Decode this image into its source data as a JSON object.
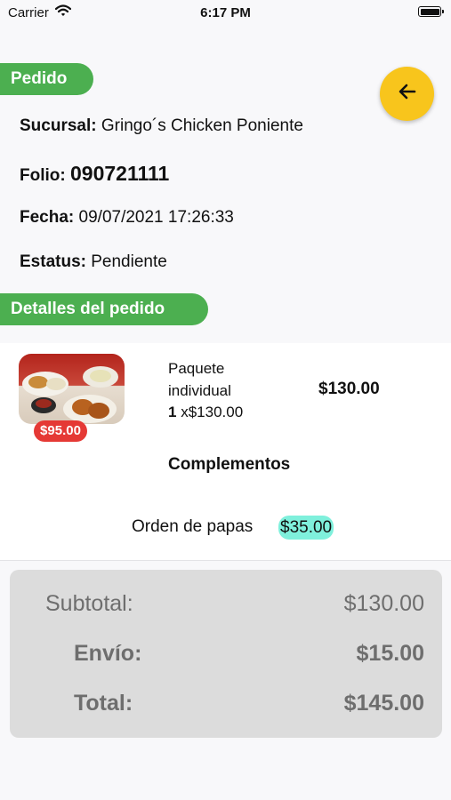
{
  "status_bar": {
    "carrier": "Carrier",
    "time": "6:17 PM"
  },
  "order": {
    "section_title": "Pedido",
    "sucursal_label": "Sucursal:",
    "sucursal_value": "Gringo´s Chicken Poniente",
    "folio_label": "Folio:",
    "folio_value": "090721111",
    "fecha_label": "Fecha:",
    "fecha_value": "09/07/2021 17:26:33",
    "estatus_label": "Estatus:",
    "estatus_value": "Pendiente"
  },
  "details": {
    "section_title": "Detalles del pedido",
    "item": {
      "badge_price": "$95.00",
      "name": "Paquete individual",
      "quantity": "1",
      "unit_price": "x$130.00",
      "total": "$130.00"
    },
    "complementos_title": "Complementos",
    "complementos": [
      {
        "name": "Orden de papas",
        "price": "$35.00"
      }
    ]
  },
  "totals": {
    "subtotal_label": "Subtotal:",
    "subtotal_value": "$130.00",
    "envio_label": "Envío:",
    "envio_value": "$15.00",
    "total_label": "Total:",
    "total_value": "$145.00"
  },
  "colors": {
    "accent_green": "#4caf50",
    "back_button": "#f8c51c",
    "badge_red": "#e53935",
    "complement_highlight": "#7ff0dc"
  },
  "icons": {
    "back": "arrow-left-icon",
    "wifi": "wifi-icon",
    "battery": "battery-icon"
  }
}
